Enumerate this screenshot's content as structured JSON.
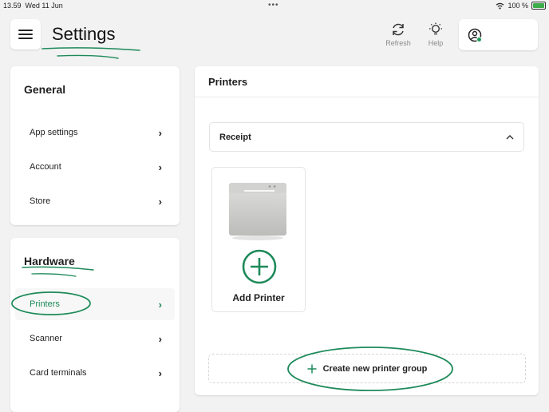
{
  "status_bar": {
    "time": "13.59",
    "date": "Wed 11 Jun",
    "battery": "100 %"
  },
  "header": {
    "title": "Settings",
    "refresh_label": "Refresh",
    "help_label": "Help"
  },
  "sidebar": {
    "general_title": "General",
    "general_items": [
      {
        "label": "App settings"
      },
      {
        "label": "Account"
      },
      {
        "label": "Store"
      }
    ],
    "hardware_title": "Hardware",
    "hardware_items": [
      {
        "label": "Printers",
        "active": true
      },
      {
        "label": "Scanner"
      },
      {
        "label": "Card terminals"
      }
    ]
  },
  "main": {
    "title": "Printers",
    "group_name": "Receipt",
    "add_printer_label": "Add Printer",
    "create_group_label": "Create new printer group"
  },
  "colors": {
    "accent": "#1e8a5a",
    "background": "#f2f2f2"
  }
}
